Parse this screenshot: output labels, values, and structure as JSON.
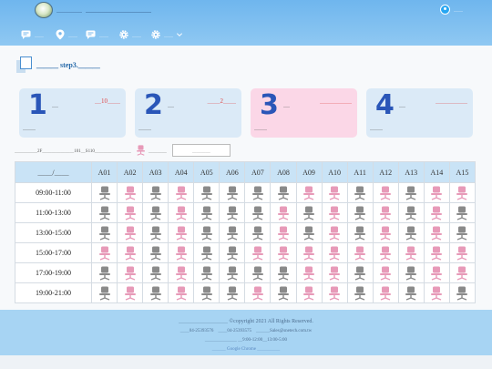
{
  "header": {
    "brand_small": "＿＿＿＿",
    "brand_large": "＿＿＿＿＿＿＿＿＿",
    "login_label": "＿＿"
  },
  "nav": [
    {
      "label": "＿＿",
      "icon": "chat-icon"
    },
    {
      "label": "＿＿",
      "icon": "location-pin-icon"
    },
    {
      "label": "＿＿",
      "icon": "chat-icon"
    },
    {
      "label": "＿＿",
      "icon": "gear-icon"
    },
    {
      "label": "＿＿",
      "icon": "gear-dropdown-icon"
    }
  ],
  "page": {
    "step_title": "＿＿＿ step3.＿＿＿"
  },
  "steps": [
    {
      "num": "1",
      "unit": "＿",
      "title": "＿10＿＿",
      "tail": "＿＿",
      "bg": "#dbeaf7"
    },
    {
      "num": "2",
      "unit": "＿",
      "title": "＿＿2＿＿",
      "tail": "＿＿",
      "bg": "#dbeaf7"
    },
    {
      "num": "3",
      "unit": "＿",
      "title": "＿＿＿＿＿",
      "tail": "＿＿",
      "bg": "#fbd7e7"
    },
    {
      "num": "4",
      "unit": "＿",
      "title": "＿＿＿＿＿",
      "tail": "＿＿",
      "bg": "#dbeaf7"
    }
  ],
  "info": {
    "note": "＿＿＿＿＿2F＿＿＿＿＿＿＿101＿S110＿＿＿＿＿＿＿＿",
    "legend_label": "＿＿＿＿",
    "box_text": "＿＿＿＿"
  },
  "table": {
    "corner": "＿＿/＿＿",
    "seats": [
      "A01",
      "A02",
      "A03",
      "A04",
      "A05",
      "A06",
      "A07",
      "A08",
      "A09",
      "A10",
      "A11",
      "A12",
      "A13",
      "A14",
      "A15"
    ],
    "times": [
      "09:00-11:00",
      "11:00-13:00",
      "13:00-15:00",
      "15:00-17:00",
      "17:00-19:00",
      "19:00-21:00"
    ],
    "states": [
      [
        "g",
        "p",
        "g",
        "p",
        "g",
        "g",
        "g",
        "g",
        "p",
        "p",
        "g",
        "p",
        "g",
        "p",
        "p"
      ],
      [
        "g",
        "p",
        "g",
        "p",
        "g",
        "g",
        "g",
        "p",
        "g",
        "p",
        "g",
        "p",
        "g",
        "p",
        "g"
      ],
      [
        "g",
        "p",
        "g",
        "p",
        "g",
        "g",
        "g",
        "p",
        "g",
        "p",
        "g",
        "p",
        "g",
        "p",
        "g"
      ],
      [
        "p",
        "p",
        "g",
        "p",
        "g",
        "g",
        "p",
        "p",
        "p",
        "p",
        "p",
        "p",
        "p",
        "p",
        "p"
      ],
      [
        "g",
        "p",
        "g",
        "p",
        "g",
        "g",
        "g",
        "g",
        "p",
        "p",
        "g",
        "p",
        "g",
        "p",
        "p"
      ],
      [
        "g",
        "p",
        "g",
        "p",
        "g",
        "g",
        "p",
        "g",
        "p",
        "p",
        "g",
        "p",
        "g",
        "p",
        "g"
      ]
    ],
    "colors": {
      "available": "#8a8a8a",
      "booked": "#e79ab8"
    }
  },
  "footer": {
    "line1": "＿＿＿＿＿＿＿＿＿ ©copyright 2021 All Rights Reserved.",
    "line2": "＿＿04-25393576　＿＿04-25393575　＿＿＿Sales@snetech.com.tw",
    "line3": "＿＿＿＿＿＿＿ ＿9:00-12:00＿13:00-5:00",
    "line4": "＿＿＿ Google Chrome ＿＿＿＿＿"
  }
}
